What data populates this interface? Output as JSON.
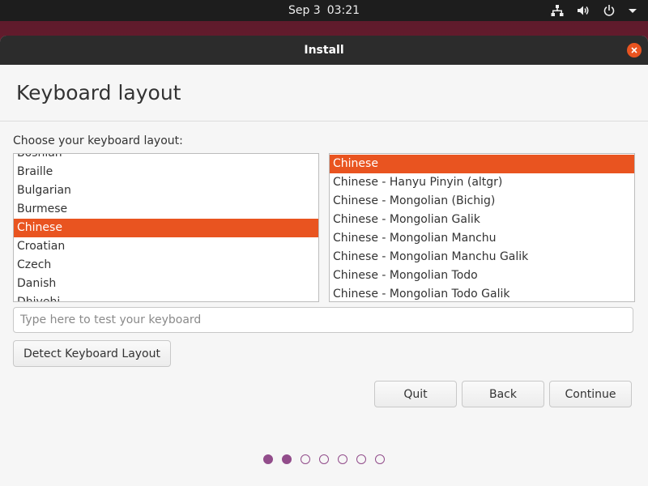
{
  "topbar": {
    "date": "Sep 3",
    "time": "03:21",
    "icons": [
      "network-icon",
      "volume-icon",
      "power-icon",
      "chevron-down-icon"
    ]
  },
  "window": {
    "title": "Install",
    "close_icon": "close-icon"
  },
  "page": {
    "heading": "Keyboard layout",
    "prompt": "Choose your keyboard layout:"
  },
  "layouts": {
    "items": [
      "Bosnian",
      "Braille",
      "Bulgarian",
      "Burmese",
      "Chinese",
      "Croatian",
      "Czech",
      "Danish",
      "Dhivehi"
    ],
    "selected": "Chinese"
  },
  "variants": {
    "items": [
      "Chinese",
      "Chinese - Hanyu Pinyin (altgr)",
      "Chinese - Mongolian (Bichig)",
      "Chinese - Mongolian Galik",
      "Chinese - Mongolian Manchu",
      "Chinese - Mongolian Manchu Galik",
      "Chinese - Mongolian Todo",
      "Chinese - Mongolian Todo Galik"
    ],
    "selected": "Chinese"
  },
  "test_input": {
    "placeholder": "Type here to test your keyboard",
    "value": ""
  },
  "buttons": {
    "detect": "Detect Keyboard Layout",
    "quit": "Quit",
    "back": "Back",
    "continue": "Continue"
  },
  "progress": {
    "total_steps": 7,
    "completed_steps": 2
  },
  "colors": {
    "accent": "#e95420",
    "progress": "#924d8b",
    "titlebar": "#2c2c2c",
    "topbar": "#1d1d1d"
  }
}
